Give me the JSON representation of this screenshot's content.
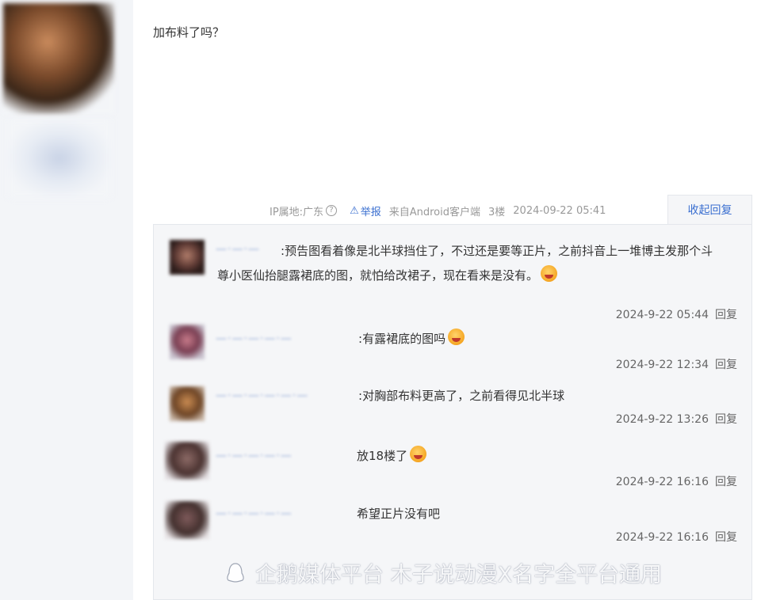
{
  "post": {
    "text": "加布料了吗？"
  },
  "meta": {
    "ip_location": "IP属地:广东",
    "help_icon": "help-circle-icon",
    "report_label": "举报",
    "source": "来自Android客户端",
    "floor": "3楼",
    "date": "2024-09-22 05:41",
    "collapse_label": "收起回复"
  },
  "replies": [
    {
      "name": "—·—·—",
      "text": "预告图看着像是北半球挡住了，不过还是要等正片，之前抖音上一堆博主发那个斗尊小医仙抬腿露裙底的图，就怕给改裙子，现在看来是没有。",
      "time": "2024-9-22 05:44",
      "reply_label": "回复"
    },
    {
      "name": "—·—·—·—·—",
      "text": "有露裙底的图吗",
      "time": "2024-9-22 12:34",
      "reply_label": "回复"
    },
    {
      "name": "—·—·—·—·—·—",
      "text": "对胸部布料更高了，之前看得见北半球",
      "time": "2024-9-22 13:26",
      "reply_label": "回复"
    },
    {
      "name": "—·—·—·—·—",
      "text": "放18楼了",
      "time": "2024-9-22 16:16",
      "reply_label": "回复"
    },
    {
      "name": "—·—·—·—·—",
      "text": "希望正片没有吧",
      "time": "2024-9-22 16:16",
      "reply_label": "回复"
    }
  ],
  "watermark": {
    "text": "企鹅媒体平台 木子说动漫X名字全平台通用"
  },
  "colors": {
    "link": "#3a6fd0",
    "panel_bg": "#f5f6f8",
    "sidebar_bg": "#f3f5f8"
  }
}
